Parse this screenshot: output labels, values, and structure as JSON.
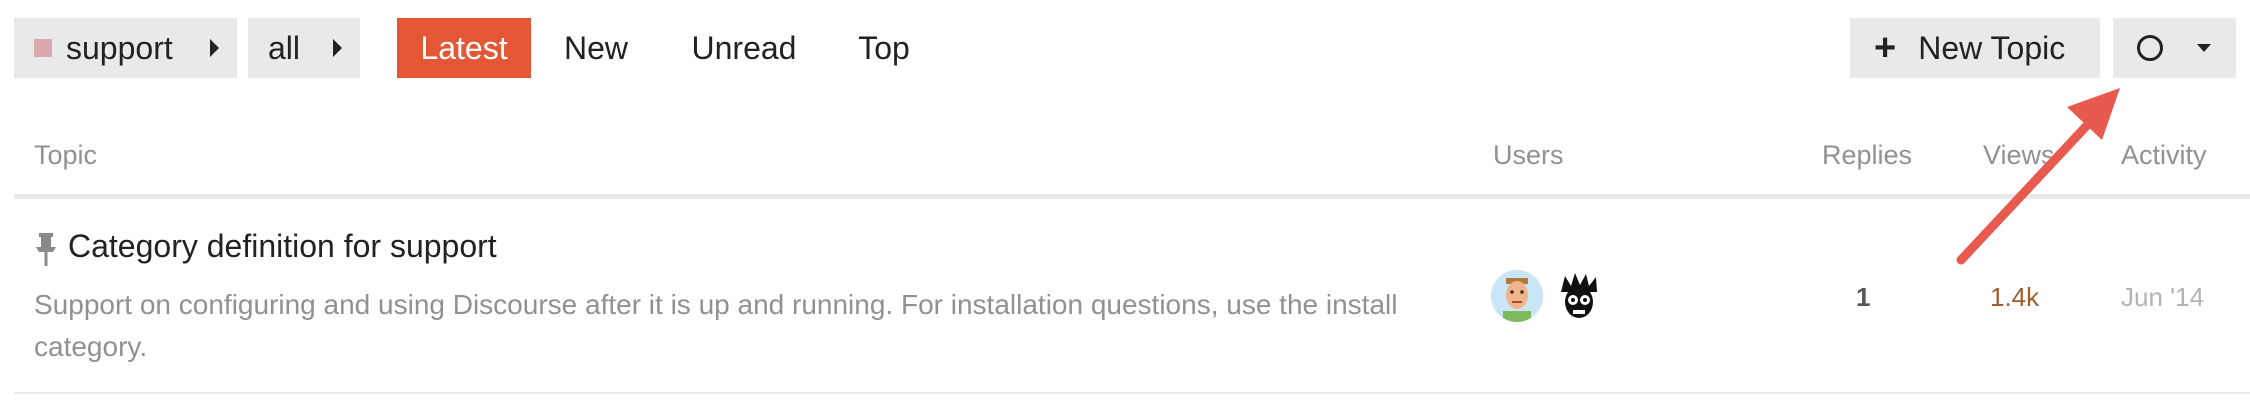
{
  "breadcrumbs": [
    {
      "label": "support",
      "swatch_color": "#d8a9ad",
      "icon": "caret-right-icon"
    },
    {
      "label": "all",
      "icon": "caret-right-icon"
    }
  ],
  "nav_tabs": [
    {
      "label": "Latest",
      "active": true
    },
    {
      "label": "New"
    },
    {
      "label": "Unread"
    },
    {
      "label": "Top"
    }
  ],
  "actions": {
    "new_topic_label": "New Topic",
    "new_topic_icon": "plus-icon",
    "notifications_icon": "circle-icon",
    "dropdown_icon": "caret-down-icon"
  },
  "table": {
    "headers": {
      "topic": "Topic",
      "users": "Users",
      "replies": "Replies",
      "views": "Views",
      "activity": "Activity"
    },
    "rows": [
      {
        "pinned": true,
        "title": "Category definition for support",
        "excerpt": "Support on configuring and using Discourse after it is up and running. For installation questions, use the install category.",
        "users": [
          "avatar-1",
          "avatar-2"
        ],
        "replies": "1",
        "views": "1.4k",
        "activity": "Jun '14"
      }
    ]
  },
  "colors": {
    "accent": "#e45735",
    "annotation_arrow": "#e85a4f",
    "views_highlight": "#9f5d2d"
  }
}
